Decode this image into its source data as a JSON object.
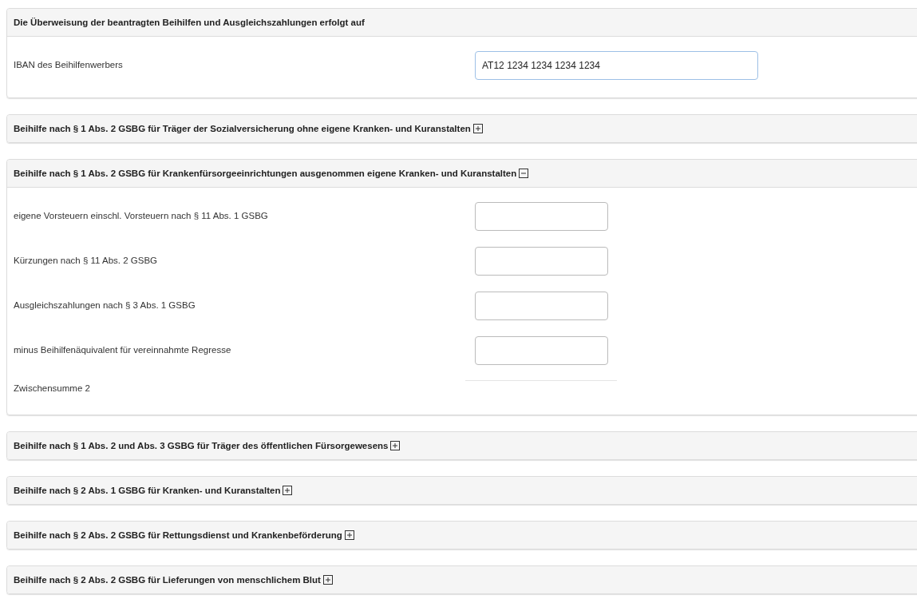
{
  "sections": [
    {
      "title": "Die Überweisung der beantragten Beihilfen und Ausgleichszahlungen erfolgt auf",
      "kind": "plain",
      "expanded": true,
      "fields": [
        {
          "kind": "wide",
          "label": "IBAN des Beihilfenwerbers",
          "value": "AT12 1234 1234 1234 1234"
        }
      ]
    },
    {
      "title": "Beihilfe nach § 1 Abs. 2 GSBG für Träger der Sozialversicherung ohne eigene Kranken- und Kuranstalten",
      "kind": "toggle",
      "expanded": false
    },
    {
      "title": "Beihilfe nach § 1 Abs. 2 GSBG für Krankenfürsorgeeinrichtungen ausgenommen eigene Kranken- und Kuranstalten",
      "kind": "toggle",
      "expanded": true,
      "fields": [
        {
          "kind": "amount",
          "label": "eigene Vorsteuern einschl. Vorsteuern nach § 11 Abs. 1 GSBG"
        },
        {
          "kind": "amount",
          "label": "Kürzungen nach § 11 Abs. 2 GSBG"
        },
        {
          "kind": "amount",
          "label": "Ausgleichszahlungen nach § 3 Abs. 1 GSBG"
        },
        {
          "kind": "amount",
          "label": "minus Beihilfenäquivalent für vereinnahmte Regresse"
        },
        {
          "kind": "total",
          "label": "Zwischensumme 2"
        }
      ]
    },
    {
      "title": "Beihilfe nach § 1 Abs. 2 und Abs. 3 GSBG für Träger des öffentlichen Fürsorgewesens",
      "kind": "toggle",
      "expanded": false
    },
    {
      "title": "Beihilfe nach § 2 Abs. 1 GSBG für Kranken- und Kuranstalten",
      "kind": "toggle",
      "expanded": false
    },
    {
      "title": "Beihilfe nach § 2 Abs. 2 GSBG für Rettungsdienst und Krankenbeförderung",
      "kind": "toggle",
      "expanded": false
    },
    {
      "title": "Beihilfe nach § 2 Abs. 2 GSBG für Lieferungen von menschlichem Blut",
      "kind": "toggle",
      "expanded": false
    }
  ]
}
